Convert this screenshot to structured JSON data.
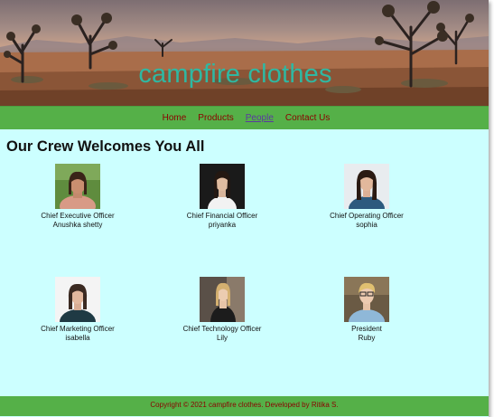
{
  "header": {
    "brand": "campfire clothes"
  },
  "nav": {
    "items": [
      {
        "label": "Home"
      },
      {
        "label": "Products"
      },
      {
        "label": "People"
      },
      {
        "label": "Contact Us"
      }
    ],
    "active": "People"
  },
  "main": {
    "heading": "Our Crew Welcomes You All",
    "members": [
      {
        "title": "Chief Executive Officer",
        "name": "Anushka shetty"
      },
      {
        "title": "Chief Financial Officer",
        "name": "priyanka"
      },
      {
        "title": "Chief Operating Officer",
        "name": "sophia"
      },
      {
        "title": "Chief Marketing Officer",
        "name": "isabella"
      },
      {
        "title": "Chief Technology Officer",
        "name": "Lily"
      },
      {
        "title": "President",
        "name": "Ruby"
      }
    ]
  },
  "footer": {
    "text": "Copyright © 2021 campfire clothes. Developed by Ritika S."
  },
  "colors": {
    "page_bg": "#ccffff",
    "bar_green": "#55b048",
    "brand_teal": "#2fb8a2",
    "link_red": "#8b0000"
  }
}
